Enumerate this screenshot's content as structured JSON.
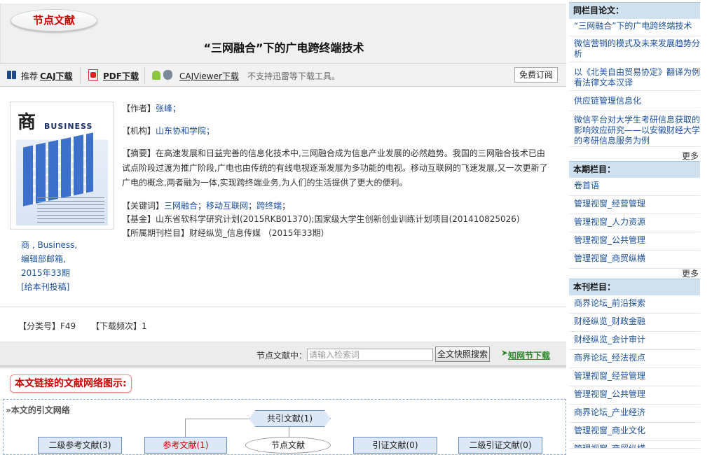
{
  "header": {
    "tag": "节点文献",
    "title": "“三网融合”下的广电跨终端技术"
  },
  "toolbar": {
    "recommend": "推荐",
    "caj": "CAJ下载",
    "pdf": "PDF下载",
    "viewer": "CAJViewer下载",
    "note": "不支持迅雷等下载工具。",
    "subscribe": "免费订阅"
  },
  "cover": {
    "logo_char": "商",
    "logo_word": "BUSINESS",
    "journal": "商 , Business,",
    "email": "编辑部邮箱,",
    "issue": "2015年33期",
    "contribute": "[给本刊投稿]"
  },
  "meta": {
    "author_label": "【作者】",
    "author": "张峰；",
    "org_label": "【机构】",
    "org": "山东协和学院；",
    "abstract_label": "【摘要】",
    "abstract": "在高速发展和日益完善的信息化技术中,三网融合成为信息产业发展的必然趋势。我国的三网融合技术已由试点阶段过渡为推广阶段,广电也由传统的有线电视逐渐发展为多功能的电视。移动互联网的飞速发展,又一次更新了广电的概念,两者融为一体,实现跨终端业务,为人们的生活提供了更大的便利。",
    "keywords_label": "【关键词】",
    "kw1": "三网融合",
    "kw2": "移动互联网",
    "kw3": "跨终端",
    "kw_sep": "；",
    "fund_label": "【基金】",
    "fund": "山东省软科学研究计划(2015RKB01370);国家级大学生创新创业训练计划项目(201410825026)",
    "column_label": "【所属期刊栏目】",
    "column": "财经纵览_信息传媒 （2015年33期）",
    "class_label": "【分类号】",
    "class": "F49",
    "dl_label": "【下载频次】",
    "dl": "1"
  },
  "search": {
    "label": "节点文献中：",
    "placeholder": "请输入检索词",
    "button": "全文快照搜索",
    "cnki": "知网节下载"
  },
  "network": {
    "tag": "本文链接的文献网络图示:",
    "heading": "»本文的引文网络",
    "co_cited": "共引文献(1)",
    "l2ref": "二级参考文献(3)",
    "ref": "参考文献(1)",
    "node": "节点文献",
    "cite": "引证文献(0)",
    "l2cite": "二级引证文献(0)"
  },
  "sidebar": {
    "same_col": {
      "title": "同栏目论文：",
      "items": [
        "“三网融合”下的广电跨终端技术",
        "微信营销的模式及未来发展趋势分析",
        "以《北美自由贸易协定》翻译为例看法律文本汉译",
        "供应链管理信息化",
        "微信平台对大学生考研信息获取的影响效应研究——以安徽财经大学的考研信息服务为例"
      ],
      "more": "更多"
    },
    "this_issue": {
      "title": "本期栏目：",
      "items": [
        "卷首语",
        "管理视窗_经营管理",
        "管理视窗_人力资源",
        "管理视窗_公共管理",
        "管理视窗_商贸纵横"
      ],
      "more": "更多"
    },
    "journal_cols": {
      "title": "本刊栏目：",
      "items": [
        "商界论坛_前沿探索",
        "财经纵览_财政金融",
        "财经纵览_会计审计",
        "商界论坛_经法视点",
        "管理视窗_经营管理",
        "管理视窗_公共管理",
        "商界论坛_产业经济",
        "管理视窗_商业文化",
        "管理视窗_商贸纵横"
      ]
    }
  }
}
